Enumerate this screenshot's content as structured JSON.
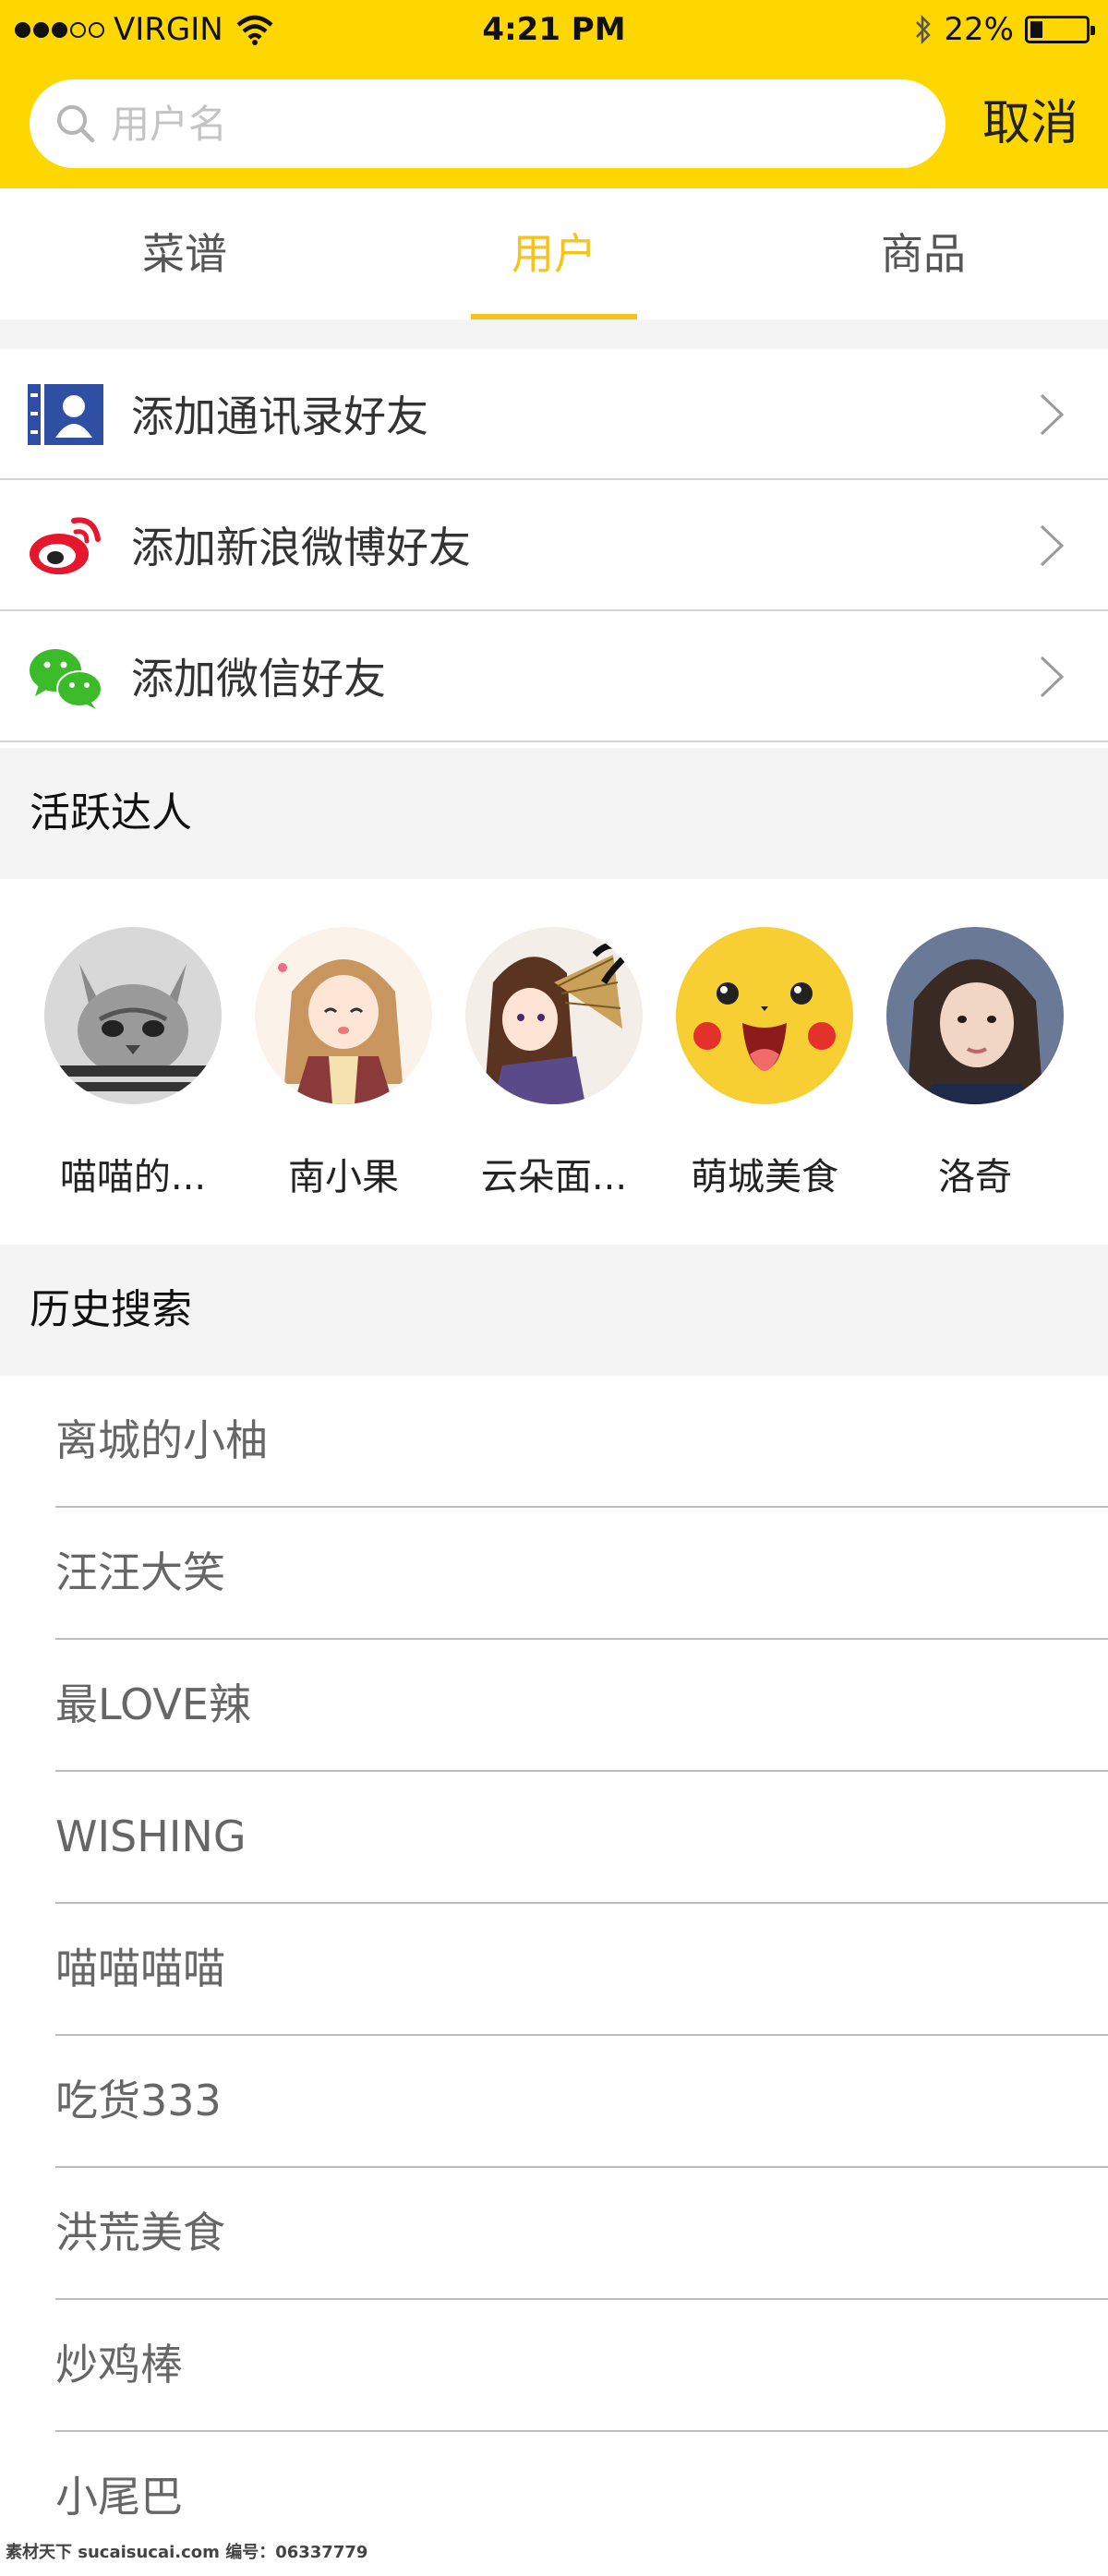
{
  "status_bar": {
    "carrier": "VIRGIN",
    "time": "4:21 PM",
    "battery": "22%",
    "battery_level": 0.22
  },
  "search": {
    "placeholder": "用户名",
    "cancel_label": "取消"
  },
  "tabs": [
    {
      "label": "菜谱",
      "active": false
    },
    {
      "label": "用户",
      "active": true
    },
    {
      "label": "商品",
      "active": false
    }
  ],
  "add_friends": [
    {
      "label": "添加通讯录好友",
      "icon": "contacts-icon"
    },
    {
      "label": "添加新浪微博好友",
      "icon": "weibo-icon"
    },
    {
      "label": "添加微信好友",
      "icon": "wechat-icon"
    }
  ],
  "active_talents": {
    "title": "活跃达人",
    "users": [
      {
        "name": "喵喵的...",
        "avatar": "cat-avatar"
      },
      {
        "name": "南小果",
        "avatar": "anime-girl-avatar"
      },
      {
        "name": "云朵面...",
        "avatar": "anime-fan-avatar"
      },
      {
        "name": "萌城美食",
        "avatar": "pikachu-avatar"
      },
      {
        "name": "洛奇",
        "avatar": "photo-avatar"
      }
    ]
  },
  "history": {
    "title": "历史搜索",
    "items": [
      "离城的小柚",
      "汪汪大笑",
      "最LOVE辣",
      "WISHING",
      "喵喵喵喵",
      "吃货333",
      "洪荒美食",
      "炒鸡棒",
      "小尾巴"
    ]
  },
  "watermark": "素材天下 sucaisucai.com  编号：06337779",
  "colors": {
    "header_yellow": "#FFD700",
    "tab_active": "#F8C21C",
    "section_bg": "#f4f4f4"
  }
}
